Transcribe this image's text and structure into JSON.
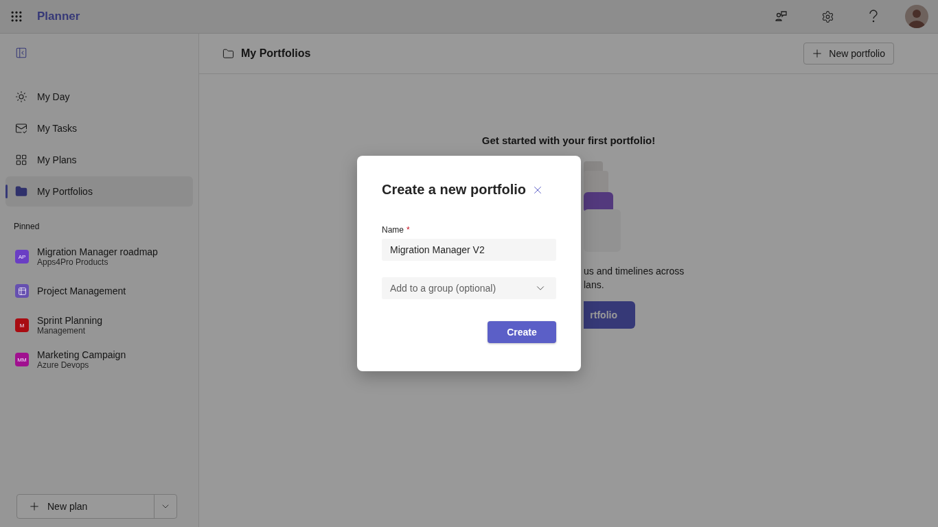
{
  "app": {
    "title": "Planner"
  },
  "sidebar": {
    "items": [
      {
        "kind": "day",
        "label": "My Day",
        "selected": false
      },
      {
        "kind": "tasks",
        "label": "My Tasks",
        "selected": false
      },
      {
        "kind": "plans",
        "label": "My Plans",
        "selected": false
      },
      {
        "kind": "portfolios",
        "label": "My Portfolios",
        "selected": true
      }
    ],
    "pinned_heading": "Pinned",
    "pinned": [
      {
        "kind": "initials",
        "initials": "AP",
        "color": "#6a3ec4",
        "title": "Migration Manager roadmap",
        "subtitle": "Apps4Pro Products"
      },
      {
        "kind": "icon",
        "color": "#6650b0",
        "title": "Project Management"
      },
      {
        "kind": "initials",
        "initials": "M",
        "color": "#a80c12",
        "title": "Sprint Planning",
        "subtitle": "Management"
      },
      {
        "kind": "initials",
        "initials": "MM",
        "color": "#a0108f",
        "title": "Marketing Campaign",
        "subtitle": "Azure Devops"
      }
    ],
    "new_plan": "New plan"
  },
  "main": {
    "title": "My Portfolios",
    "new_button": "New portfolio",
    "empty_title": "Get started with your first portfolio!",
    "description_lines": [
      "us and timelines across",
      "lans."
    ],
    "cta_fragment": "rtfolio"
  },
  "dialog": {
    "title": "Create a new portfolio",
    "name_label": "Name",
    "required_mark": "*",
    "name_value": "Migration Manager V2",
    "group_placeholder": "Add to a group (optional)",
    "create": "Create"
  }
}
